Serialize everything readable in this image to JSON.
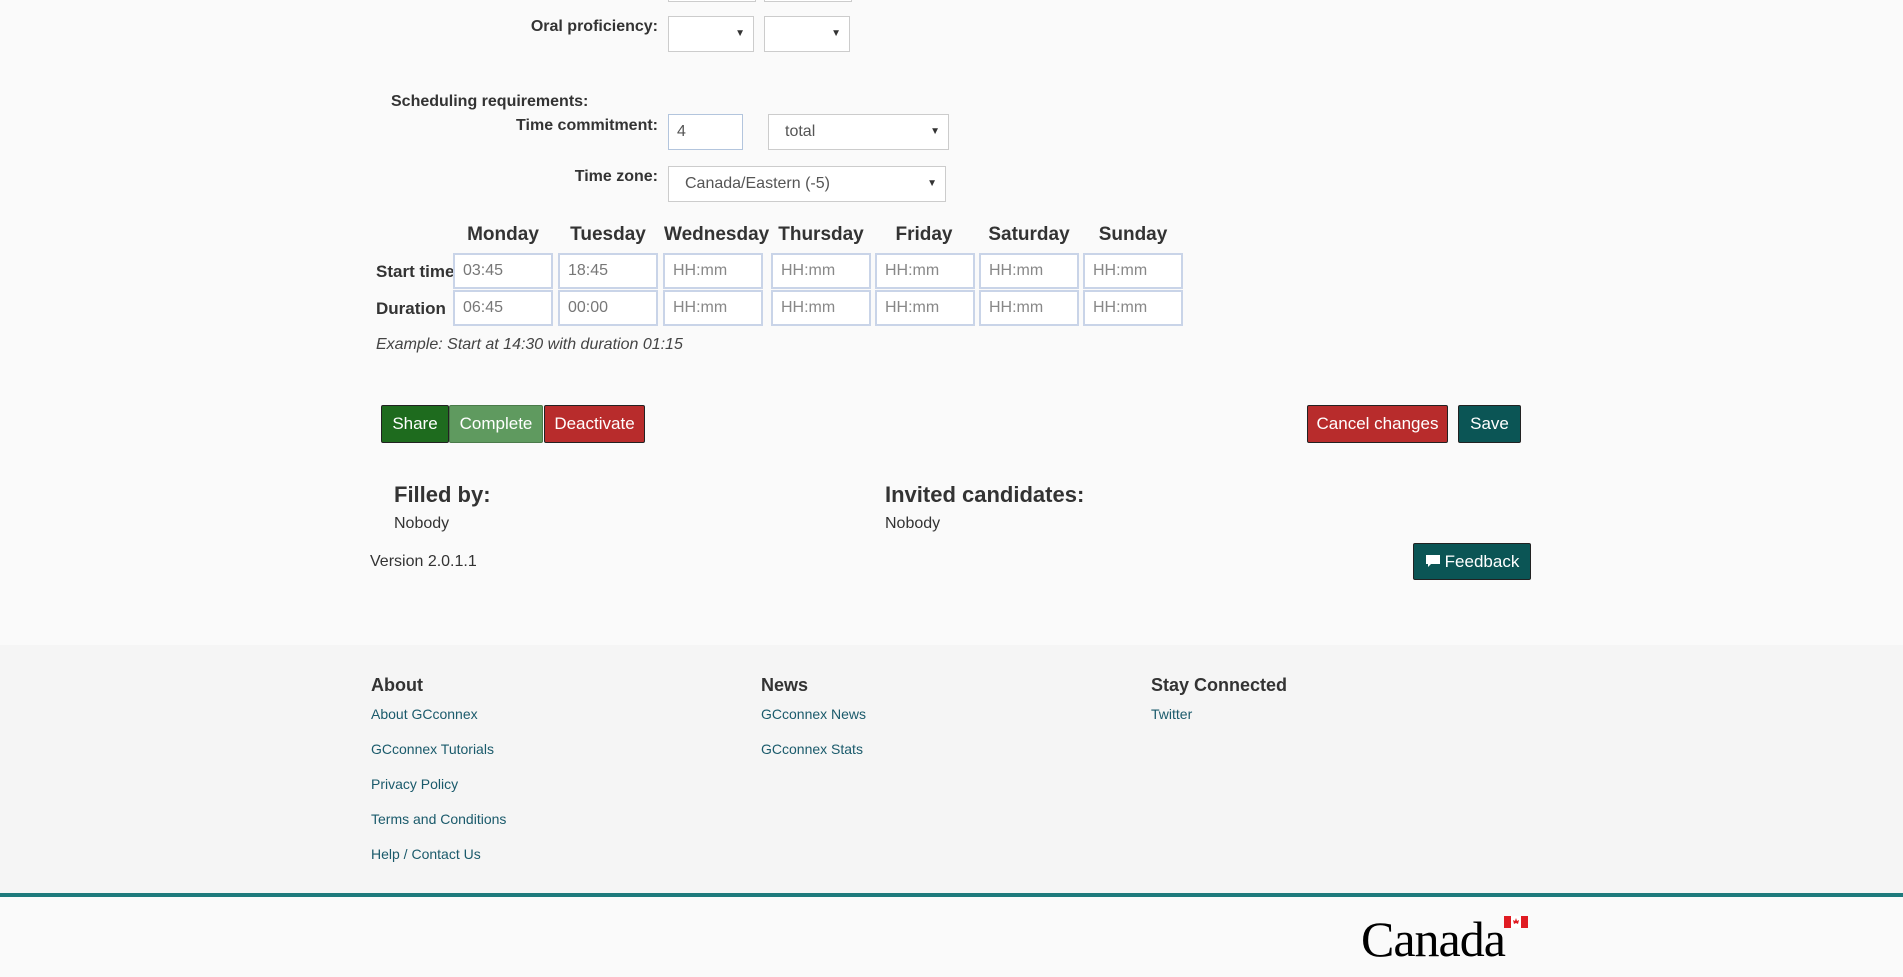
{
  "form": {
    "oral_proficiency_label": "Oral proficiency:",
    "scheduling_label": "Scheduling requirements:",
    "time_commitment_label": "Time commitment:",
    "time_commitment_value": "4",
    "time_commitment_unit": "total",
    "time_zone_label": "Time zone:",
    "time_zone_value": "Canada/Eastern (-5)"
  },
  "schedule": {
    "days": [
      "Monday",
      "Tuesday",
      "Wednesday",
      "Thursday",
      "Friday",
      "Saturday",
      "Sunday"
    ],
    "start_label": "Start time",
    "duration_label": "Duration",
    "start_values": [
      "03:45",
      "18:45",
      "",
      "",
      "",
      "",
      ""
    ],
    "duration_values": [
      "06:45",
      "00:00",
      "",
      "",
      "",
      "",
      ""
    ],
    "placeholder": "HH:mm",
    "example": "Example: Start at 14:30 with duration 01:15"
  },
  "actions": {
    "share": "Share",
    "complete": "Complete",
    "deactivate": "Deactivate",
    "cancel": "Cancel changes",
    "save": "Save"
  },
  "filled": {
    "heading": "Filled by:",
    "value": "Nobody"
  },
  "invited": {
    "heading": "Invited candidates:",
    "value": "Nobody"
  },
  "version": "Version 2.0.1.1",
  "feedback": "Feedback",
  "footer": {
    "about": {
      "heading": "About",
      "links": [
        "About GCconnex",
        "GCconnex Tutorials",
        "Privacy Policy",
        "Terms and Conditions",
        "Help / Contact Us"
      ]
    },
    "news": {
      "heading": "News",
      "links": [
        "GCconnex News",
        "GCconnex Stats"
      ]
    },
    "connected": {
      "heading": "Stay Connected",
      "links": [
        "Twitter"
      ]
    },
    "wordmark": "Canada"
  },
  "colors": {
    "share": "#1e6b1e",
    "complete": "#5f9a5f",
    "deactivate": "#b82c2c",
    "cancel": "#b82c2c",
    "save": "#0b5555",
    "feedback": "#0b5555",
    "footer_line": "#1e7a7c"
  }
}
